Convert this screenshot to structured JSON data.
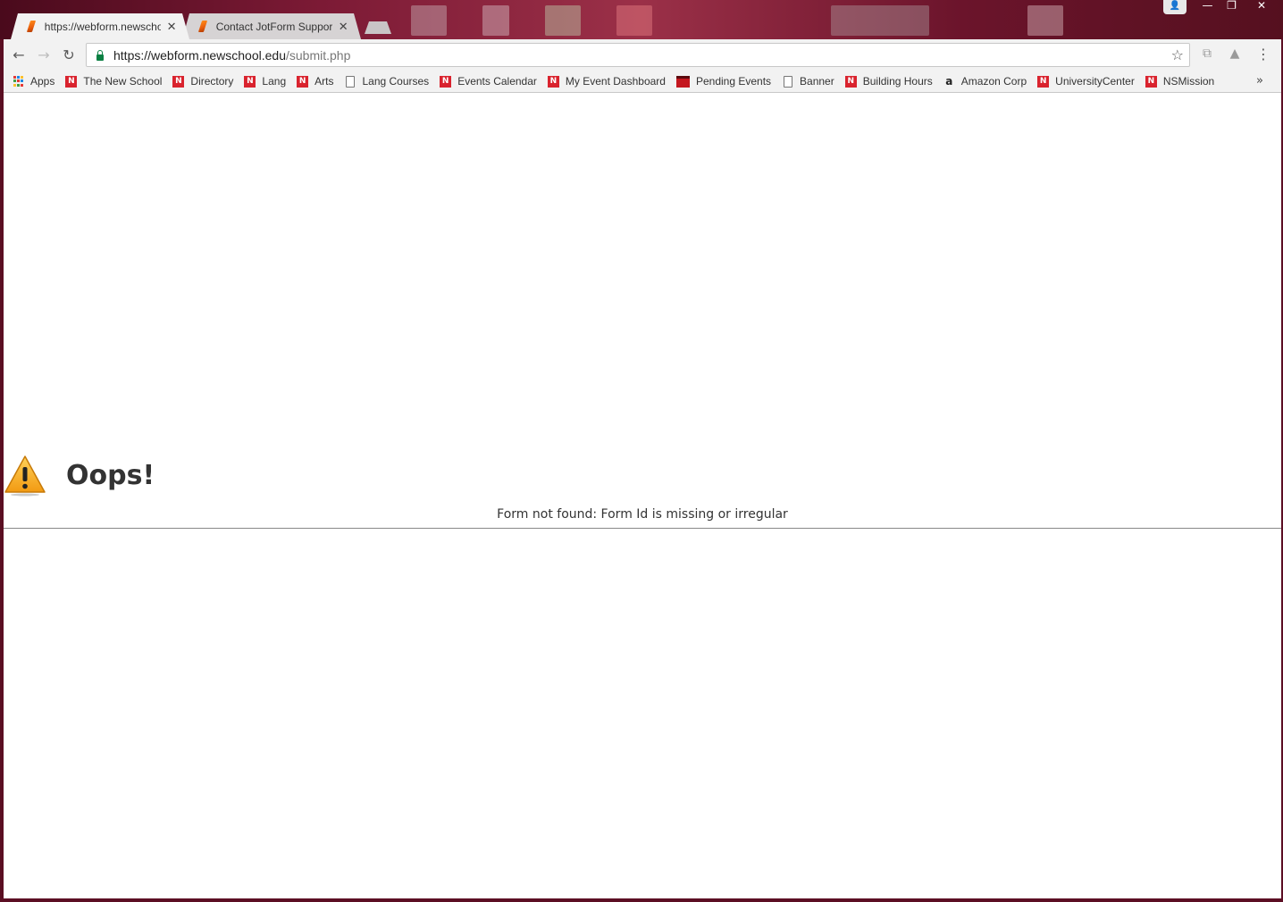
{
  "tabs": [
    {
      "label": "https://webform.newscho",
      "active": true
    },
    {
      "label": "Contact JotForm Support",
      "active": false
    }
  ],
  "window_controls": {
    "minimize": "—",
    "restore": "❐",
    "close": "✕"
  },
  "address_bar": {
    "host": "https://webform.newschool.edu",
    "path": "/submit.php"
  },
  "bookmarks": [
    {
      "label": "Apps",
      "icon": "apps-grid-icon"
    },
    {
      "label": "The New School",
      "icon": "new-school-icon"
    },
    {
      "label": "Directory",
      "icon": "new-school-icon"
    },
    {
      "label": "Lang",
      "icon": "new-school-icon"
    },
    {
      "label": "Arts",
      "icon": "new-school-icon"
    },
    {
      "label": "Lang Courses",
      "icon": "page-icon"
    },
    {
      "label": "Events Calendar",
      "icon": "new-school-icon"
    },
    {
      "label": "My Event Dashboard",
      "icon": "new-school-icon"
    },
    {
      "label": "Pending Events",
      "icon": "calendar-icon"
    },
    {
      "label": "Banner",
      "icon": "page-icon"
    },
    {
      "label": "Building Hours",
      "icon": "new-school-icon"
    },
    {
      "label": "Amazon Corp",
      "icon": "amazon-icon"
    },
    {
      "label": "UniversityCenter",
      "icon": "new-school-icon"
    },
    {
      "label": "NSMission",
      "icon": "new-school-icon"
    }
  ],
  "overflow_label": "»",
  "page": {
    "title": "Oops!",
    "message": "Form not found: Form Id is missing or irregular"
  }
}
